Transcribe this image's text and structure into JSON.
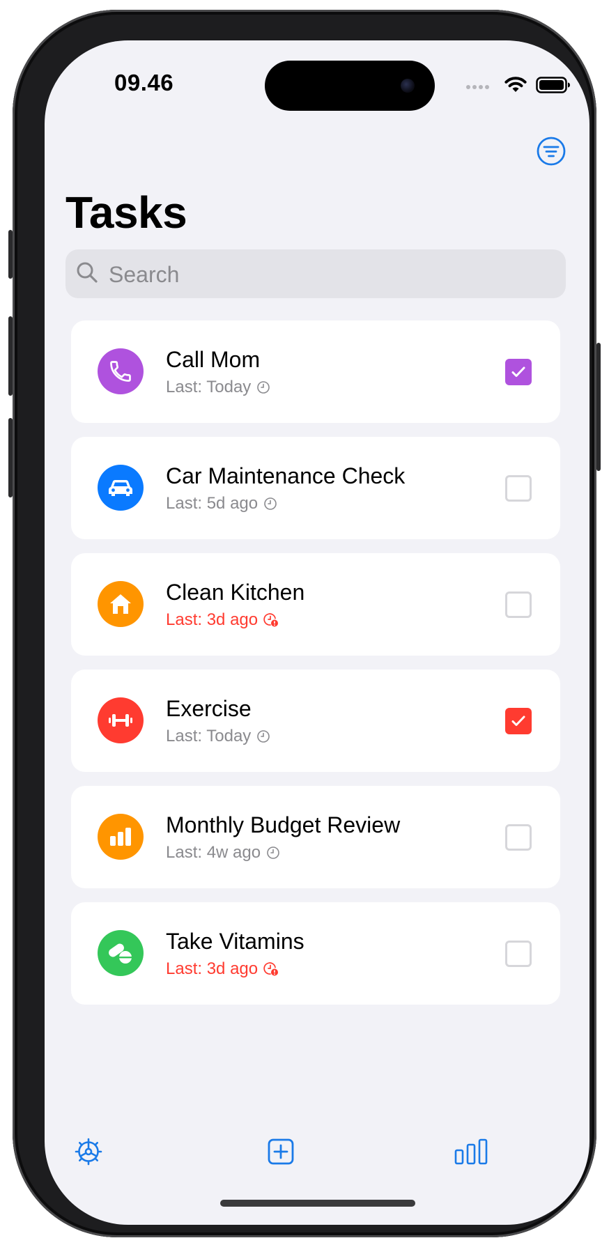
{
  "status_bar": {
    "time": "09.46"
  },
  "header": {
    "title": "Tasks"
  },
  "search": {
    "placeholder": "Search"
  },
  "colors": {
    "accent": "#1a7ae8",
    "purple": "#af52de",
    "blue": "#0a7aff",
    "orange": "#ff9500",
    "red": "#ff3b30",
    "green": "#34c759",
    "overdue_text": "#ff3b30"
  },
  "tasks": [
    {
      "name": "Call Mom",
      "last": "Last: Today",
      "overdue": false,
      "checked": true,
      "icon": "phone-icon",
      "color": "#af52de"
    },
    {
      "name": "Car Maintenance Check",
      "last": "Last: 5d ago",
      "overdue": false,
      "checked": false,
      "icon": "car-icon",
      "color": "#0a7aff"
    },
    {
      "name": "Clean Kitchen",
      "last": "Last: 3d ago",
      "overdue": true,
      "checked": false,
      "icon": "house-icon",
      "color": "#ff9500"
    },
    {
      "name": "Exercise",
      "last": "Last: Today",
      "overdue": false,
      "checked": true,
      "icon": "dumbbell-icon",
      "color": "#ff3b30"
    },
    {
      "name": "Monthly Budget Review",
      "last": "Last: 4w ago",
      "overdue": false,
      "checked": false,
      "icon": "bar-chart-icon",
      "color": "#ff9500"
    },
    {
      "name": "Take Vitamins",
      "last": "Last: 3d ago",
      "overdue": true,
      "checked": false,
      "icon": "pills-icon",
      "color": "#34c759"
    }
  ],
  "tab_bar": {
    "items": [
      {
        "name": "settings",
        "icon": "gear-icon"
      },
      {
        "name": "add-task",
        "icon": "plus-square-icon"
      },
      {
        "name": "statistics",
        "icon": "bar-chart-icon"
      }
    ]
  }
}
